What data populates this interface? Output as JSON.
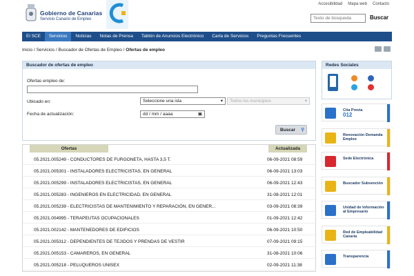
{
  "header": {
    "title": "Gobierno de Canarias",
    "subtitle": "Servicio Canario de Empleo",
    "links": [
      "Accesibilidad",
      "Mapa web",
      "Contacto"
    ],
    "search_placeholder": "Texto de búsqueda",
    "search_button": "Buscar"
  },
  "nav": [
    {
      "label": "El SCE",
      "active": false
    },
    {
      "label": "Servicios",
      "active": true
    },
    {
      "label": "Noticias",
      "active": false
    },
    {
      "label": "Notas de Prensa",
      "active": false
    },
    {
      "label": "Tablón de Anuncios Electrónico",
      "active": false
    },
    {
      "label": "Carta de Servicios",
      "active": false
    },
    {
      "label": "Preguntas Frecuentes",
      "active": false
    }
  ],
  "breadcrumb": {
    "path": "Inicio / Servicios / Buscador de Ofertas de Empleo / ",
    "current": "Ofertas de empleo"
  },
  "search_panel": {
    "title": "Buscador de ofertas de empleo",
    "offers_label": "Ofertas empleo de:",
    "location_label": "Ubicado en:",
    "island_select": "Seleccione una isla",
    "municipality_select": "Todos los municipios",
    "date_label": "Fecha de actualización:",
    "date_placeholder": "dd / mm / aaaa",
    "button": "Buscar"
  },
  "results": {
    "col_offers": "Ofertas",
    "col_updated": "Actualizada",
    "rows": [
      {
        "title": "05.2021.005249 - CONDUCTORES DE FURGONETA, HASTA 3,5 T.",
        "date": "06-09-2021 08:59"
      },
      {
        "title": "05.2021.005301 - INSTALADORES ELECTRICISTAS, EN GENERAL",
        "date": "06-09-2021 13:03"
      },
      {
        "title": "05.2021.005299 - INSTALADORES ELECTRICISTAS, EN GENERAL",
        "date": "06-09-2021 12:43"
      },
      {
        "title": "05.2021.005283 - INGENIEROS EN ELECTRICIDAD, EN GENERAL",
        "date": "31-08-2021 12:01"
      },
      {
        "title": "05.2021.005239 - ELECTRICISTAS DE MANTENIMIENTO Y REPARACIÓN, EN GENER...",
        "date": "03-09-2021 08:39"
      },
      {
        "title": "05.2021.004995 - TERAPEUTAS OCUPACIONALES",
        "date": "01-09-2021 12:42"
      },
      {
        "title": "05.2021.002142 - MANTENEDORES DE EDIFICIOS",
        "date": "06-09-2021 10:50"
      },
      {
        "title": "05.2021.005312 - DEPENDIENTES DE TEJIDOS Y PRENDAS DE VESTIR",
        "date": "07-09-2021 09:15"
      },
      {
        "title": "05.2021.005153 - CAMAREROS, EN GENERAL",
        "date": "31-08-2021 10:06"
      },
      {
        "title": "05.2021.005218 - PELUQUEROS UNISEX",
        "date": "02-09-2021 11:38"
      }
    ]
  },
  "sidebar": {
    "social_title": "Redes Sociales",
    "items": [
      {
        "label": "Cita Previa",
        "extra": "012",
        "color": "#2b71c9"
      },
      {
        "label": "Renovación Demanda Empleo",
        "extra": "",
        "color": "#e8b416"
      },
      {
        "label": "Sede Electrónica",
        "extra": "",
        "color": "#d6282e"
      },
      {
        "label": "Buscador Subvención",
        "extra": "",
        "color": "#e8b416"
      },
      {
        "label": "Unidad de Información al Empresario",
        "extra": "",
        "color": "#2b71c9"
      },
      {
        "label": "Red de Empleabilidad Canaria",
        "extra": "",
        "color": "#e8b416"
      },
      {
        "label": "Transparencia",
        "extra": "",
        "color": "#2b71c9"
      }
    ]
  },
  "colors": {
    "nav_bg": "#1e4e8a",
    "nav_active": "#3a78bf",
    "panel_head": "#dbe8f3",
    "table_head": "#d6d6b8"
  }
}
